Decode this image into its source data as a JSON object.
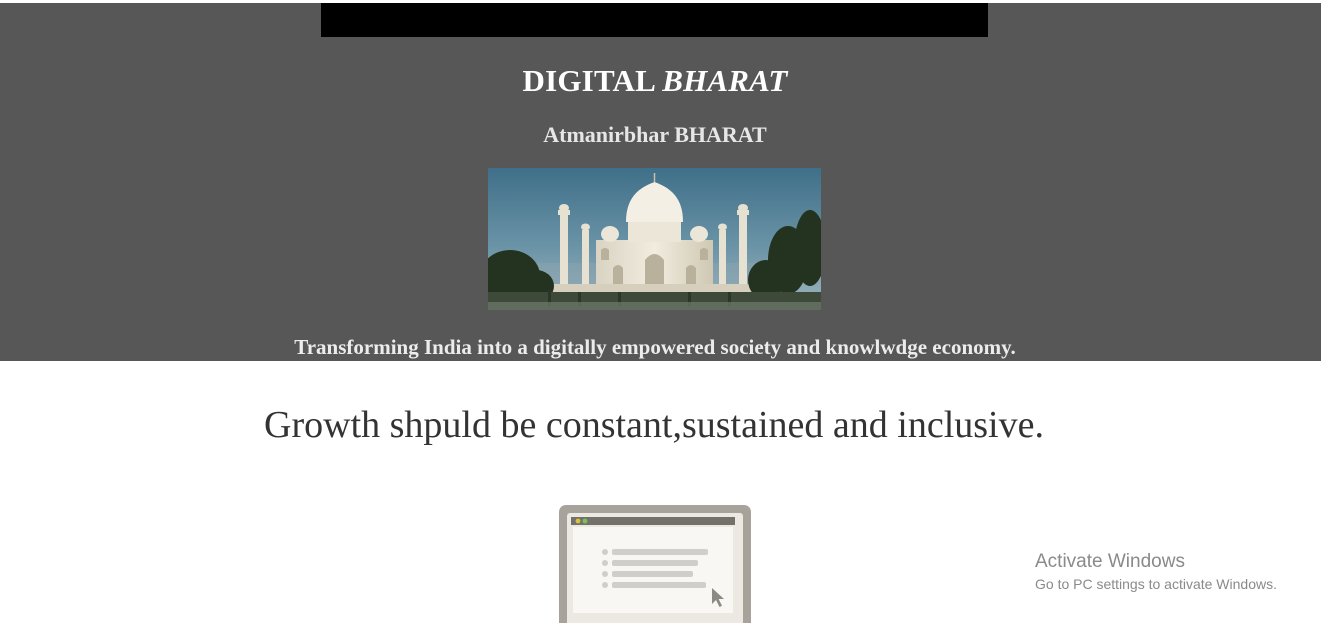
{
  "hero": {
    "title_main": "DIGITAL",
    "title_emphasis": "BHARAT",
    "subtitle": "Atmanirbhar BHARAT",
    "image_icon": "taj-mahal-photo",
    "tagline": "Transforming India into a digitally empowered society and knowlwdge economy."
  },
  "main": {
    "statement": "Growth shpuld be constant,sustained and inclusive.",
    "illustration_icon": "browser-window-list-icon"
  },
  "os_overlay": {
    "title": "Activate Windows",
    "subtitle": "Go to PC settings to activate Windows."
  },
  "colors": {
    "hero_background": "#575757",
    "navbar": "#000000",
    "text_dark": "#333333",
    "watermark": "#8a8a8a"
  }
}
